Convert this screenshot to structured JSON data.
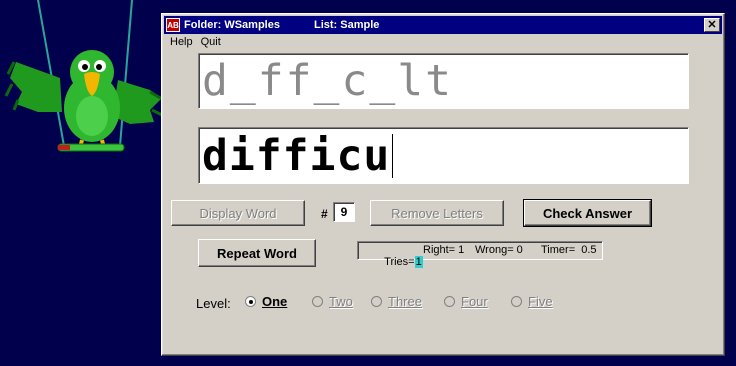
{
  "window": {
    "title_folder": "Folder: WSamples",
    "title_list": "List: Sample",
    "close_symbol": "✕",
    "app_icon": "AB"
  },
  "menu": {
    "help": "Help",
    "quit": "Quit"
  },
  "masked_word": "d_ff_c_lt",
  "typed_word": "difficu",
  "buttons": {
    "display_word": "Display Word",
    "remove_letters": "Remove Letters",
    "check_answer": "Check Answer",
    "repeat_word": "Repeat Word"
  },
  "count": {
    "label": "#",
    "value": "9"
  },
  "stats": {
    "tries_label": "Tries=",
    "tries_value": "1",
    "right": "Right= 1",
    "wrong": "Wrong= 0",
    "timer": "Timer=  0.5"
  },
  "level": {
    "label": "Level:",
    "options": [
      "One",
      "Two",
      "Three",
      "Four",
      "Five"
    ],
    "selected": "One"
  },
  "colors": {
    "desktop": "#00004d",
    "titlebar": "#000080",
    "tries_highlight": "#33cccc",
    "parrot_green": "#2fb82f"
  },
  "icons": {
    "mascot": "parrot-mascot-icon"
  }
}
